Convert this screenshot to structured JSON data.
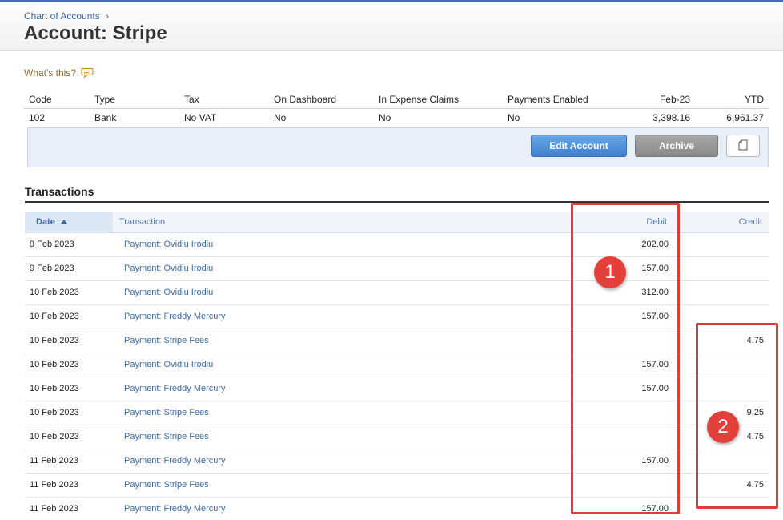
{
  "header": {
    "breadcrumb": "Chart of Accounts",
    "breadcrumb_sep": "›",
    "title": "Account: Stripe"
  },
  "help": {
    "label": "What's this?",
    "icon": "speech-bubble-icon"
  },
  "summary": {
    "columns": [
      "Code",
      "Type",
      "Tax",
      "On Dashboard",
      "In Expense Claims",
      "Payments Enabled",
      "Feb-23",
      "YTD"
    ],
    "values": [
      "102",
      "Bank",
      "No VAT",
      "No",
      "No",
      "No",
      "3,398.16",
      "6,961.37"
    ]
  },
  "actions": {
    "edit": "Edit Account",
    "archive": "Archive",
    "copy_icon": "copy-icon"
  },
  "transactions": {
    "section_title": "Transactions",
    "columns": {
      "date": "Date",
      "transaction": "Transaction",
      "debit": "Debit",
      "credit": "Credit"
    },
    "rows": [
      {
        "date": "9 Feb 2023",
        "transaction": "Payment: Ovidiu Irodiu",
        "debit": "202.00",
        "credit": ""
      },
      {
        "date": "9 Feb 2023",
        "transaction": "Payment: Ovidiu Irodiu",
        "debit": "157.00",
        "credit": ""
      },
      {
        "date": "10 Feb 2023",
        "transaction": "Payment: Ovidiu Irodiu",
        "debit": "312.00",
        "credit": ""
      },
      {
        "date": "10 Feb 2023",
        "transaction": "Payment: Freddy Mercury",
        "debit": "157.00",
        "credit": ""
      },
      {
        "date": "10 Feb 2023",
        "transaction": "Payment: Stripe Fees",
        "debit": "",
        "credit": "4.75"
      },
      {
        "date": "10 Feb 2023",
        "transaction": "Payment: Ovidiu Irodiu",
        "debit": "157.00",
        "credit": ""
      },
      {
        "date": "10 Feb 2023",
        "transaction": "Payment: Freddy Mercury",
        "debit": "157.00",
        "credit": ""
      },
      {
        "date": "10 Feb 2023",
        "transaction": "Payment: Stripe Fees",
        "debit": "",
        "credit": "9.25"
      },
      {
        "date": "10 Feb 2023",
        "transaction": "Payment: Stripe Fees",
        "debit": "",
        "credit": "4.75"
      },
      {
        "date": "11 Feb 2023",
        "transaction": "Payment: Freddy Mercury",
        "debit": "157.00",
        "credit": ""
      },
      {
        "date": "11 Feb 2023",
        "transaction": "Payment: Stripe Fees",
        "debit": "",
        "credit": "4.75"
      },
      {
        "date": "11 Feb 2023",
        "transaction": "Payment: Freddy Mercury",
        "debit": "157.00",
        "credit": ""
      }
    ]
  },
  "annotations": {
    "callout1": "1",
    "callout2": "2",
    "color": "#e23b3b"
  }
}
